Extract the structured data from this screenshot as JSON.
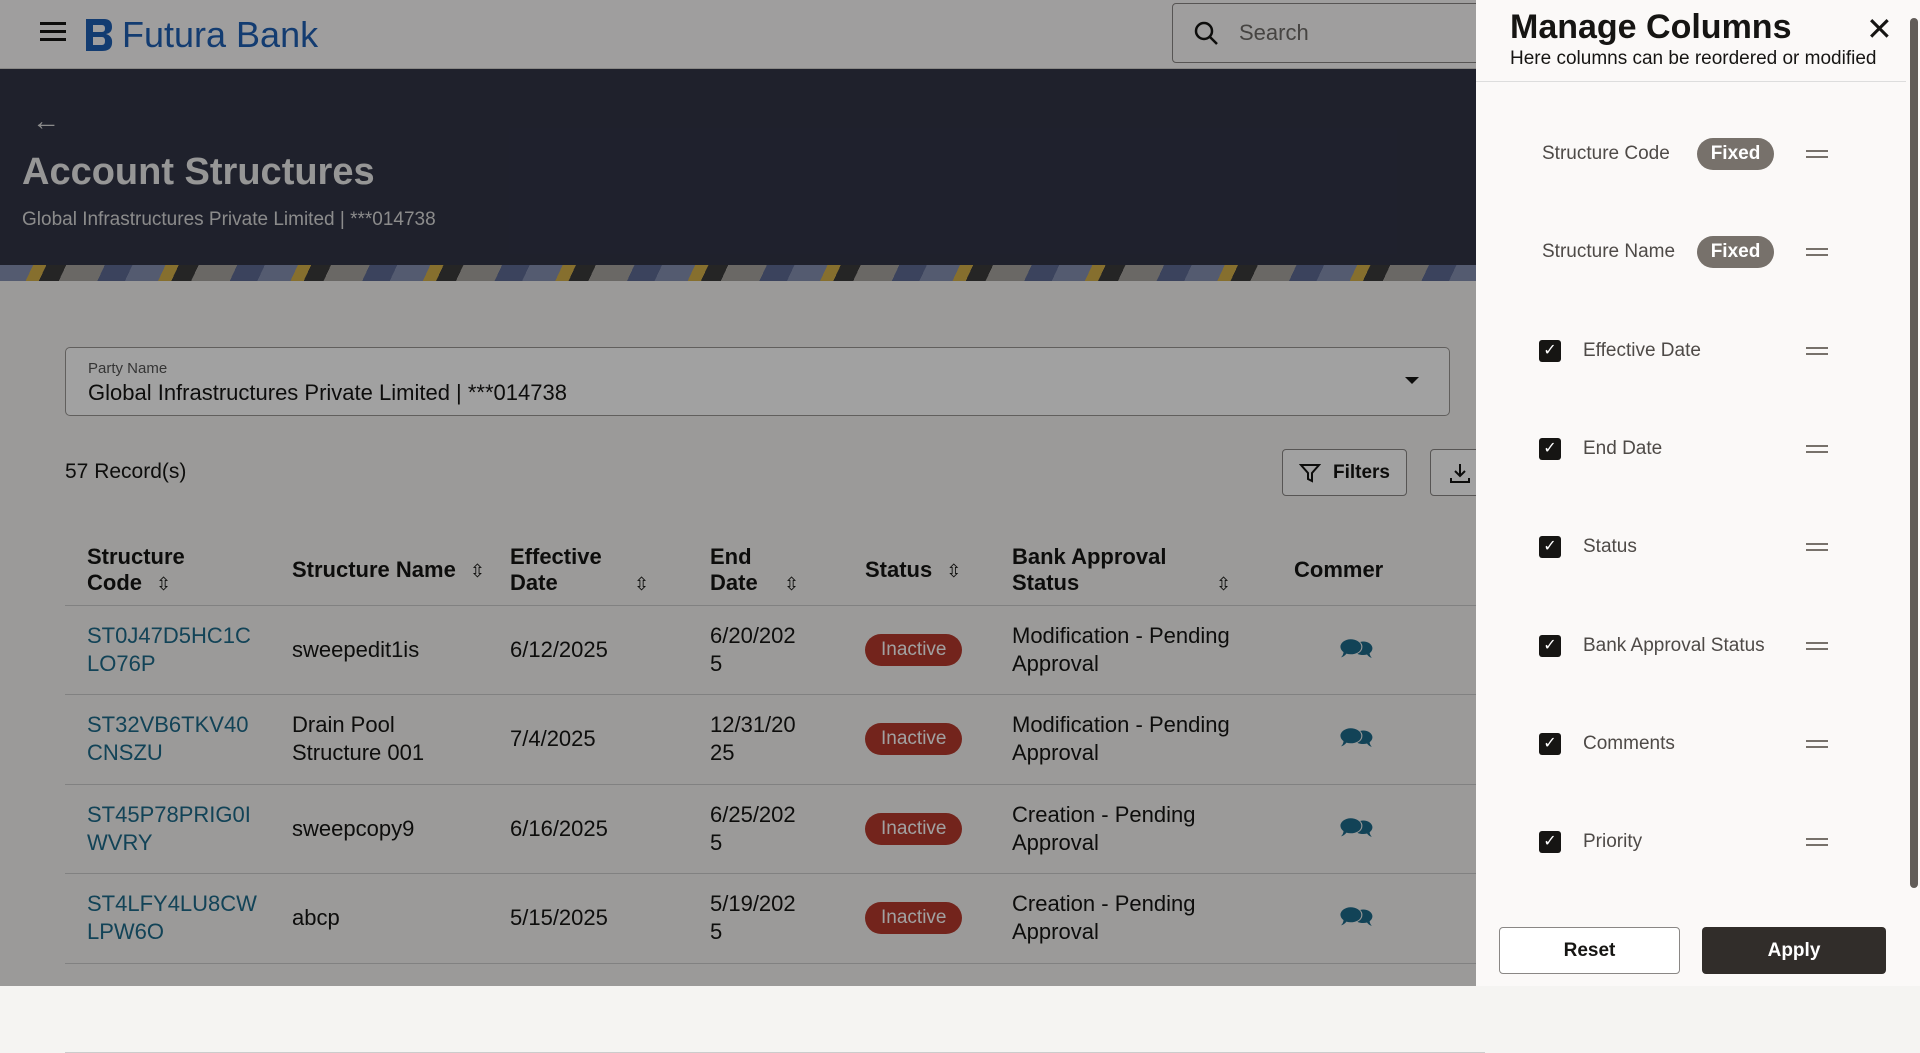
{
  "header": {
    "brand": "Futura Bank",
    "search_placeholder": "Search"
  },
  "hero": {
    "title": "Account Structures",
    "subtitle": "Global Infrastructures Private Limited | ***014738"
  },
  "party": {
    "label": "Party Name",
    "value": "Global Infrastructures  Private Limited | ***014738"
  },
  "records": "57 Record(s)",
  "toolbar": {
    "filters": "Filters"
  },
  "table": {
    "columns": [
      "Structure Code",
      "Structure Name",
      "Effective Date",
      "End Date",
      "Status",
      "Bank Approval Status",
      "Commer"
    ],
    "rows": [
      {
        "code": "ST0J47D5HC1CLO76P",
        "name": "sweepedit1is",
        "eff": "6/12/2025",
        "end": "6/20/2025",
        "status": "Inactive",
        "approval": "Modification - Pending Approval"
      },
      {
        "code": "ST32VB6TKV40CNSZU",
        "name": "Drain Pool Structure 001",
        "eff": "7/4/2025",
        "end": "12/31/2025",
        "status": "Inactive",
        "approval": "Modification - Pending Approval"
      },
      {
        "code": "ST45P78PRIG0IWVRY",
        "name": "sweepcopy9",
        "eff": "6/16/2025",
        "end": "6/25/2025",
        "status": "Inactive",
        "approval": "Creation - Pending Approval"
      },
      {
        "code": "ST4LFY4LU8CWLPW6O",
        "name": "abcp",
        "eff": "5/15/2025",
        "end": "5/19/2025",
        "status": "Inactive",
        "approval": "Creation - Pending Approval"
      }
    ]
  },
  "panel": {
    "title": "Manage Columns",
    "subtitle": "Here columns can be reordered or modified",
    "fixed_label": "Fixed",
    "items": [
      {
        "label": "Structure Code",
        "fixed": true
      },
      {
        "label": "Structure Name",
        "fixed": true
      },
      {
        "label": "Effective Date",
        "checked": true
      },
      {
        "label": "End Date",
        "checked": true
      },
      {
        "label": "Status",
        "checked": true
      },
      {
        "label": "Bank Approval Status",
        "checked": true
      },
      {
        "label": "Comments",
        "checked": true
      },
      {
        "label": "Priority",
        "checked": true
      }
    ],
    "reset": "Reset",
    "apply": "Apply"
  },
  "colors": {
    "brand": "#1f5fb4",
    "link": "#1d6a8a",
    "inactive": "#b63a2d"
  }
}
